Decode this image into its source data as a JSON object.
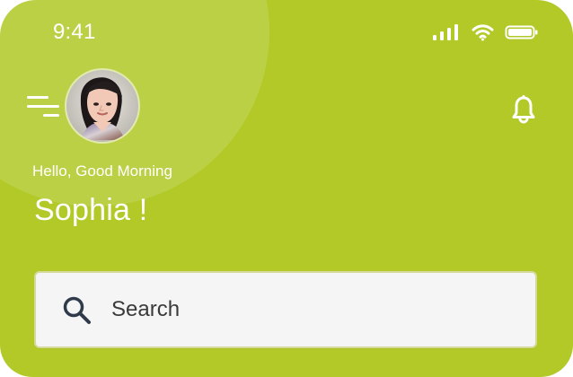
{
  "status_bar": {
    "time": "9:41",
    "icons": [
      "signal-bars-icon",
      "wifi-icon",
      "battery-icon"
    ]
  },
  "header": {
    "menu_icon": "menu-icon",
    "avatar_label": "profile-avatar",
    "notification_icon": "bell-icon"
  },
  "greeting": {
    "subtitle": "Hello, Good Morning",
    "name": "Sophia !"
  },
  "search": {
    "icon": "search-icon",
    "placeholder": "Search",
    "value": ""
  },
  "colors": {
    "background": "#b2c928",
    "text": "#ffffff",
    "search_background": "#f5f5f5",
    "search_icon": "#2f3a4a"
  }
}
